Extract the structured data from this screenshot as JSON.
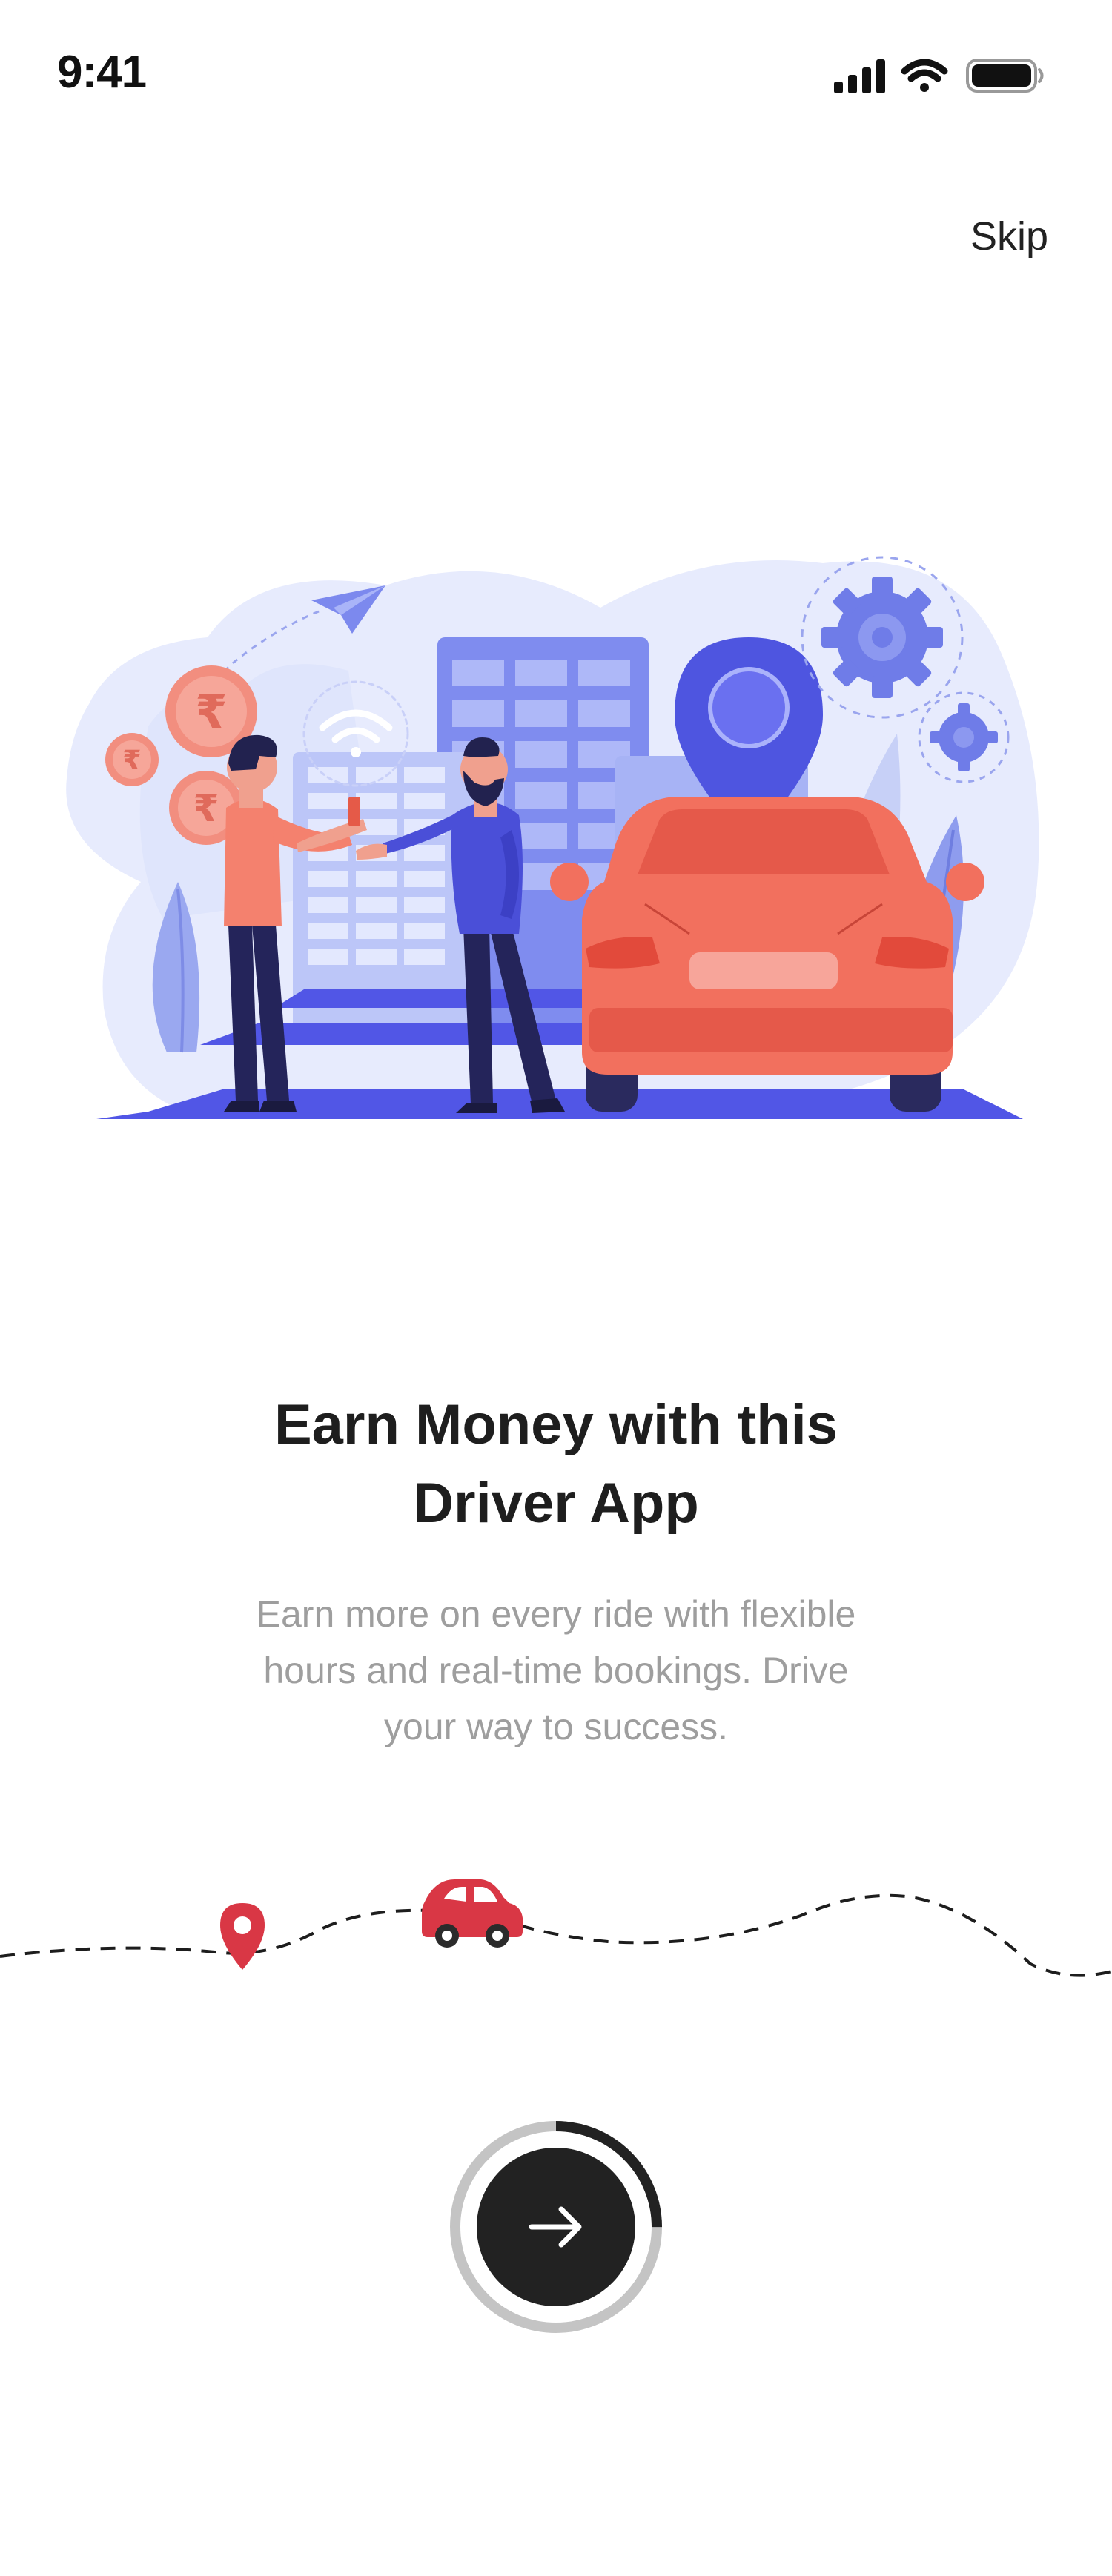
{
  "status_bar": {
    "time": "9:41",
    "icons": [
      "cellular-signal-icon",
      "wifi-icon",
      "battery-icon"
    ]
  },
  "skip_label": "Skip",
  "hero": {
    "illustration": "driver-handshake-car-illustration",
    "icons": [
      "rupee-coin-icon",
      "wifi-icon",
      "paper-plane-icon",
      "location-pin-icon",
      "gear-icon",
      "car-icon"
    ]
  },
  "onboarding": {
    "title_line1": "Earn Money with this",
    "title_line2": "Driver App",
    "description_line1": "Earn more on every ride with flexible",
    "description_line2": "hours and real-time bookings. Drive",
    "description_line3": "your way to success."
  },
  "route": {
    "icons": [
      "location-pin-icon",
      "car-icon"
    ]
  },
  "next_button": {
    "icon": "arrow-right-icon",
    "progress_fraction": 0.25
  },
  "colors": {
    "accent_dark": "#222222",
    "pin_red": "#d93745",
    "car_coral": "#f2705e",
    "illustration_blue": "#5a5fe8",
    "illustration_light": "#e6eafc",
    "progress_track": "#c4c4c4",
    "description_gray": "#9e9e9e"
  }
}
